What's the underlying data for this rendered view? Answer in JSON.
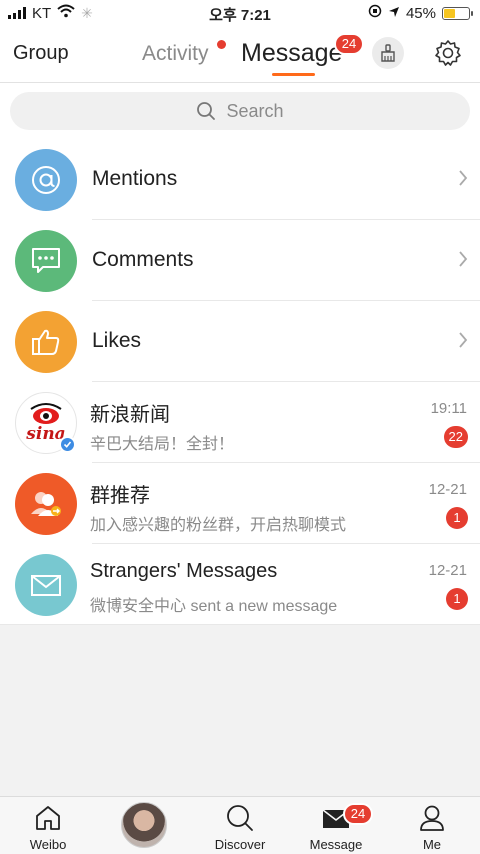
{
  "status_bar": {
    "carrier": "KT",
    "time": "오후 7:21",
    "battery": "45%"
  },
  "header": {
    "tabs": {
      "group": "Group",
      "activity": "Activity",
      "message": "Message"
    },
    "message_badge": "24"
  },
  "search": {
    "placeholder": "Search"
  },
  "menu_rows": [
    {
      "label": "Mentions",
      "icon": "at-icon",
      "color": "#6aaee0"
    },
    {
      "label": "Comments",
      "icon": "comment-icon",
      "color": "#5cb97a"
    },
    {
      "label": "Likes",
      "icon": "thumbs-up-icon",
      "color": "#f3a233"
    }
  ],
  "conversations": [
    {
      "name": "新浪新闻",
      "preview": "辛巴大结局！全封！",
      "time": "19:11",
      "unread": "22",
      "avatar_text": "sina"
    },
    {
      "name": "群推荐",
      "preview": "加入感兴趣的粉丝群，开启热聊模式",
      "time": "12-21",
      "unread": "1"
    },
    {
      "name": "Strangers' Messages",
      "preview": "微博安全中心 sent a new message",
      "time": "12-21",
      "unread": "1"
    }
  ],
  "tabbar": {
    "items": [
      {
        "label": "Weibo",
        "icon": "home-icon"
      },
      {
        "label": "",
        "icon": "user-avatar"
      },
      {
        "label": "Discover",
        "icon": "search-icon"
      },
      {
        "label": "Message",
        "icon": "envelope-icon"
      },
      {
        "label": "Me",
        "icon": "person-icon"
      }
    ],
    "message_badge": "24"
  },
  "colors": {
    "accent": "#ff6a1a",
    "badge": "#e53d30"
  }
}
